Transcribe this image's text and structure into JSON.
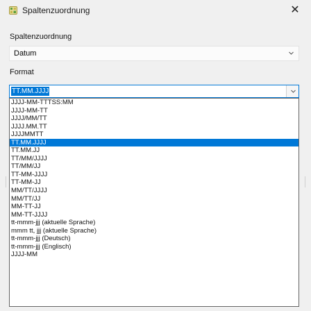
{
  "window": {
    "title": "Spaltenzuordnung",
    "close_symbol": "✕",
    "icon": "grid-app-icon"
  },
  "section_label": "Spaltenzuordnung",
  "column_select": {
    "value": "Datum",
    "icon": "chevron-down-icon"
  },
  "format_label": "Format",
  "format_combo": {
    "value": "TT.MM.JJJJ",
    "icon": "chevron-down-icon"
  },
  "format_options": [
    "JJJJ-MM-TTTSS:MM",
    "JJJJ-MM-TT",
    "JJJJ/MM/TT",
    "JJJJ.MM.TT",
    "JJJJMMTT",
    "TT.MM.JJJJ",
    "TT.MM.JJ",
    "TT/MM/JJJJ",
    "TT/MM/JJ",
    "TT-MM-JJJJ",
    "TT-MM-JJ",
    "MM/TT/JJJJ",
    "MM/TT/JJ",
    "MM-TT-JJ",
    "MM-TT-JJJJ",
    "tt-mmm-jjj (aktuelle Sprache)",
    "mmm tt, jjj (aktuelle Sprache)",
    "tt-mmm-jjj (Deutsch)",
    "tt-mmm-jjj (Englisch)",
    "JJJJ-MM"
  ],
  "selected_option": "TT.MM.JJJJ",
  "colors": {
    "accent": "#0078d7",
    "background": "#f0f0f0"
  }
}
